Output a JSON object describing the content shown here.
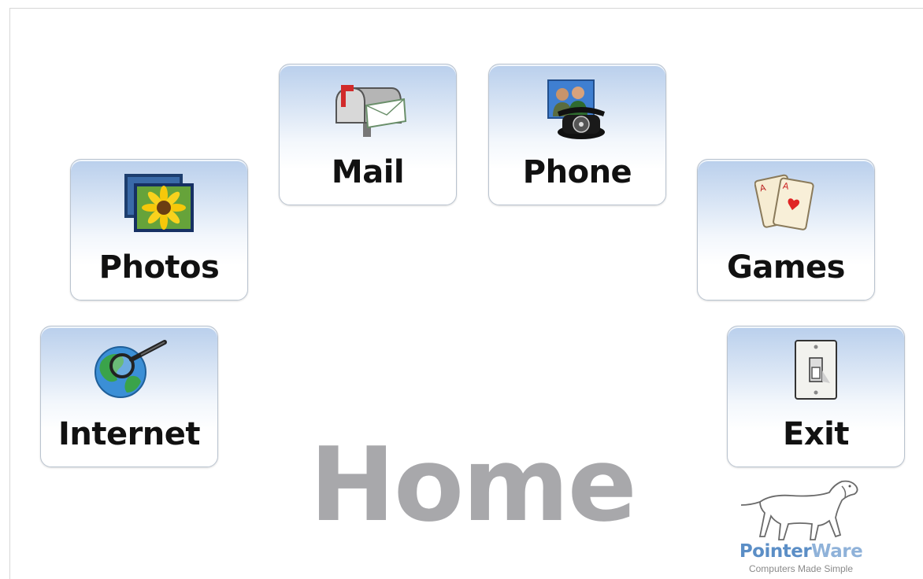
{
  "page": {
    "title": "Home"
  },
  "tiles": [
    {
      "id": "mail",
      "label": "Mail",
      "icon": "mailbox-icon"
    },
    {
      "id": "phone",
      "label": "Phone",
      "icon": "video-phone-icon"
    },
    {
      "id": "photos",
      "label": "Photos",
      "icon": "photos-icon"
    },
    {
      "id": "games",
      "label": "Games",
      "icon": "playing-cards-icon"
    },
    {
      "id": "internet",
      "label": "Internet",
      "icon": "globe-search-icon"
    },
    {
      "id": "exit",
      "label": "Exit",
      "icon": "light-switch-icon"
    }
  ],
  "brand": {
    "name_part1": "Pointer",
    "name_part2": "Ware",
    "tagline": "Computers Made Simple",
    "logo_icon": "pointer-dog-icon"
  },
  "colors": {
    "tile_top": "#b9cfec",
    "tile_border": "#b9c3cf",
    "title_gray": "#a8a8ab",
    "brand_blue": "#5b8ec6"
  }
}
